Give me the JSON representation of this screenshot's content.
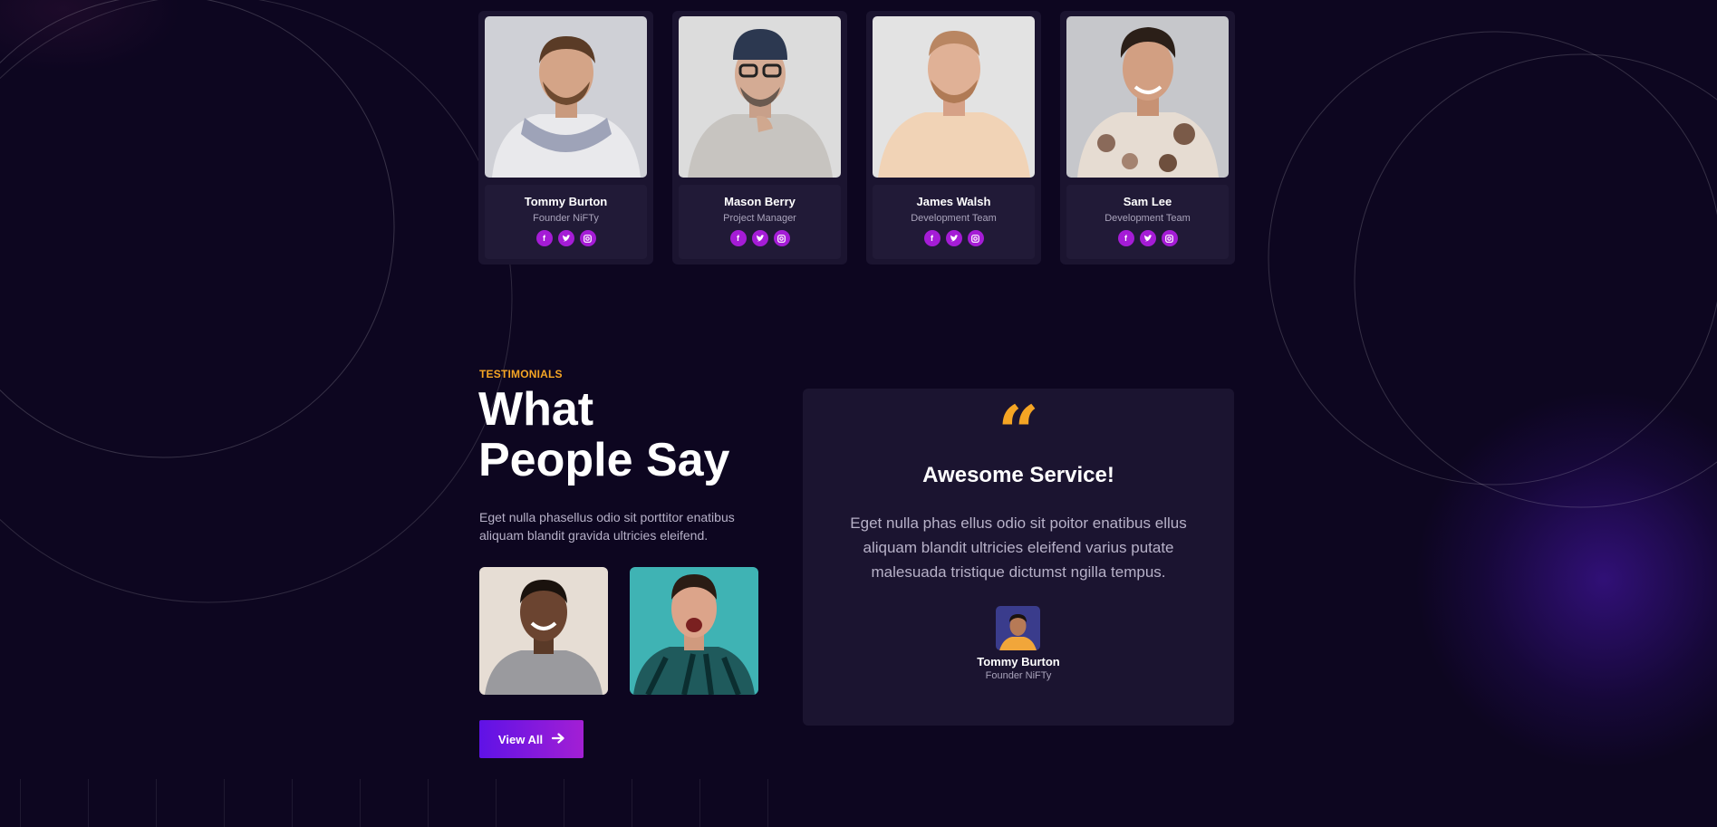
{
  "team": [
    {
      "name": "Tommy Burton",
      "role": "Founder NiFTy",
      "socials": [
        "facebook-icon",
        "twitter-icon",
        "instagram-icon"
      ]
    },
    {
      "name": "Mason Berry",
      "role": "Project Manager",
      "socials": [
        "facebook-icon",
        "twitter-icon",
        "instagram-icon"
      ]
    },
    {
      "name": "James Walsh",
      "role": "Development Team",
      "socials": [
        "facebook-icon",
        "twitter-icon",
        "instagram-icon"
      ]
    },
    {
      "name": "Sam Lee",
      "role": "Development Team",
      "socials": [
        "facebook-icon",
        "twitter-icon",
        "instagram-icon"
      ]
    }
  ],
  "testimonials": {
    "eyebrow": "TESTIMONIALS",
    "headline": "What People Say",
    "description": "Eget nulla phasellus odio sit porttitor enatibus aliquam blandit gravida ultricies eleifend.",
    "button_label": "View All",
    "card": {
      "title": "Awesome Service!",
      "body": "Eget nulla phas ellus odio sit poitor enatibus ellus aliquam blandit ultricies eleifend varius putate malesuada tristique dictumst ngilla tempus.",
      "author_name": "Tommy Burton",
      "author_role": "Founder NiFTy"
    }
  },
  "colors": {
    "background": "#0d0620",
    "accent_orange": "#f5a524",
    "accent_purple": "#a51cd6",
    "card": "#1b1430"
  }
}
